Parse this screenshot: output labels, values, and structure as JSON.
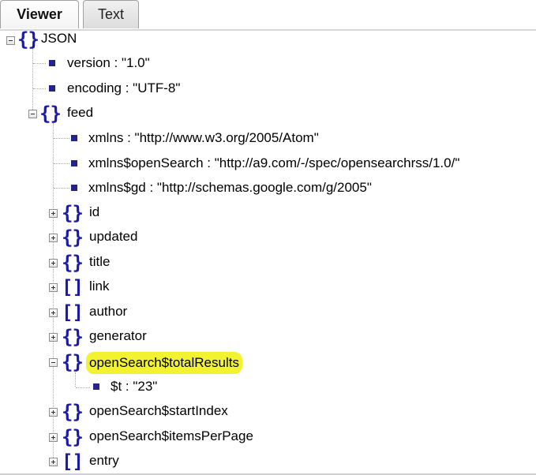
{
  "tabs": [
    {
      "label": "Viewer",
      "active": true
    },
    {
      "label": "Text",
      "active": false
    }
  ],
  "tree": {
    "root": {
      "label": "JSON"
    },
    "version": {
      "label": "version : \"1.0\""
    },
    "encoding": {
      "label": "encoding : \"UTF-8\""
    },
    "feed": {
      "label": "feed"
    },
    "xmlns": {
      "label": "xmlns : \"http://www.w3.org/2005/Atom\""
    },
    "xmlns_opensearch": {
      "label": "xmlns$openSearch : \"http://a9.com/-/spec/opensearchrss/1.0/\""
    },
    "xmlns_gd": {
      "label": "xmlns$gd : \"http://schemas.google.com/g/2005\""
    },
    "id": {
      "label": "id"
    },
    "updated": {
      "label": "updated"
    },
    "title": {
      "label": "title"
    },
    "link": {
      "label": "link"
    },
    "author": {
      "label": "author"
    },
    "generator": {
      "label": "generator"
    },
    "total_results": {
      "label": "openSearch$totalResults",
      "highlight_color": "#f2f230"
    },
    "t": {
      "label": "$t : \"23\""
    },
    "start_index": {
      "label": "openSearch$startIndex"
    },
    "items_per_page": {
      "label": "openSearch$itemsPerPage"
    },
    "entry": {
      "label": "entry"
    }
  },
  "icons": {
    "object": "curly-braces-icon",
    "array": "square-brackets-icon",
    "value": "square-bullet-icon",
    "expanded": "minus-toggle-icon",
    "collapsed": "plus-toggle-icon"
  },
  "colors": {
    "brace": "#1b1ba8",
    "bullet": "#24248c",
    "highlight": "#f2f230"
  }
}
